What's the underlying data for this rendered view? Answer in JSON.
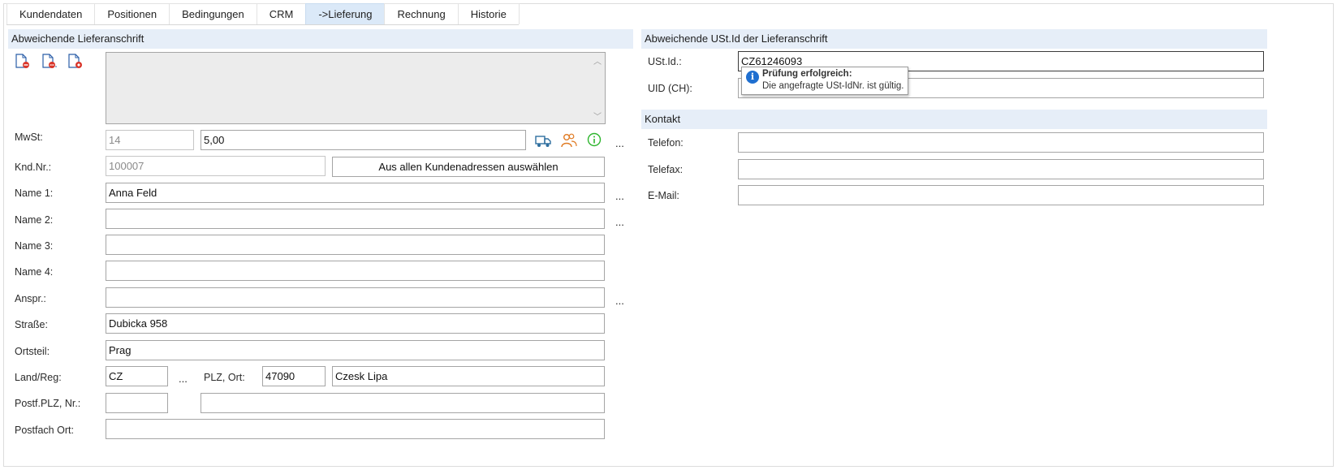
{
  "tabs": [
    {
      "label": "Kundendaten",
      "active": false
    },
    {
      "label": "Positionen",
      "active": false
    },
    {
      "label": "Bedingungen",
      "active": false
    },
    {
      "label": "CRM",
      "active": false
    },
    {
      "label": "->Lieferung",
      "active": true
    },
    {
      "label": "Rechnung",
      "active": false
    },
    {
      "label": "Historie",
      "active": false
    }
  ],
  "delivery": {
    "header": "Abweichende Lieferanschrift",
    "doc_icons": [
      "document-red-icon",
      "document-red-dots-icon",
      "document-blue-icon"
    ],
    "memo_text": "",
    "mwst": {
      "label": "MwSt:",
      "code": "14",
      "rate": "5,00"
    },
    "mwst_icons": [
      "truck-icon",
      "people-icon",
      "info-circle-icon"
    ],
    "more": "...",
    "kndnr": {
      "label": "Knd.Nr.:",
      "value": "100007"
    },
    "select_button": "Aus allen Kundenadressen auswählen",
    "name1": {
      "label": "Name 1:",
      "value": "Anna Feld"
    },
    "name2": {
      "label": "Name 2:",
      "value": ""
    },
    "name3": {
      "label": "Name 3:",
      "value": ""
    },
    "name4": {
      "label": "Name 4:",
      "value": ""
    },
    "anspr": {
      "label": "Anspr.:",
      "value": ""
    },
    "strasse": {
      "label": "Straße:",
      "value": "Dubicka 958"
    },
    "ortsteil": {
      "label": "Ortsteil:",
      "value": "Prag"
    },
    "land": {
      "label": "Land/Reg:",
      "value": "CZ"
    },
    "plzort": {
      "label": "PLZ, Ort:",
      "plz": "47090",
      "ort": "Czesk Lipa"
    },
    "postf": {
      "label": "Postf.PLZ, Nr.:",
      "plz": "",
      "nr": ""
    },
    "postfach_ort": {
      "label": "Postfach Ort:",
      "value": ""
    }
  },
  "vat": {
    "header": "Abweichende USt.Id der Lieferanschrift",
    "ustid": {
      "label": "USt.Id.:",
      "value": "CZ61246093"
    },
    "uid": {
      "label": "UID (CH):",
      "value": ""
    },
    "tooltip": {
      "title": "Prüfung erfolgreich:",
      "message": "Die angefragte USt-IdNr. ist gültig."
    }
  },
  "contact": {
    "header": "Kontakt",
    "telefon": {
      "label": "Telefon:",
      "value": ""
    },
    "telefax": {
      "label": "Telefax:",
      "value": ""
    },
    "email": {
      "label": "E-Mail:",
      "value": ""
    }
  },
  "colors": {
    "accent_tab": "#dbe9f8",
    "section_header": "#e6eef8",
    "info_blue": "#1f6fd0",
    "truck_blue": "#2f6f9f",
    "people_orange": "#e07b24",
    "info_green": "#2db52d"
  }
}
